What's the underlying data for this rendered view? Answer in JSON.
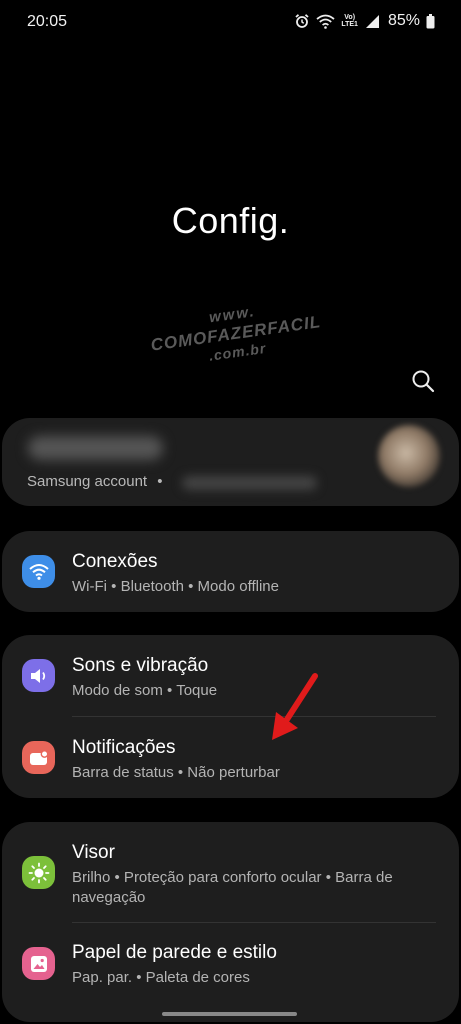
{
  "status_bar": {
    "time": "20:05",
    "lte_top": "Vo)",
    "lte_bottom": "LTE1",
    "battery": "85%",
    "icons": [
      "alarm-icon",
      "wifi-icon",
      "volte-icon",
      "signal-icon",
      "battery-icon"
    ]
  },
  "header": {
    "title": "Config.",
    "search_icon": "search-icon"
  },
  "watermark": {
    "line1": "www.",
    "line2": "COMOFAZERFACIL",
    "line3": ".com.br"
  },
  "account": {
    "subtitle": "Samsung account",
    "separator": "•"
  },
  "settings": {
    "connections": {
      "title": "Conexões",
      "subtitle": "Wi-Fi  •  Bluetooth  •  Modo offline",
      "icon": "wifi-icon",
      "color": "#3e8ee8"
    },
    "sound": {
      "title": "Sons e vibração",
      "subtitle": "Modo de som  •  Toque",
      "icon": "volume-icon",
      "color": "#7d6fe8"
    },
    "notifications": {
      "title": "Notificações",
      "subtitle": "Barra de status  •  Não perturbar",
      "icon": "notification-icon",
      "color": "#e8665a"
    },
    "display": {
      "title": "Visor",
      "subtitle": "Brilho  •  Proteção para conforto ocular  •  Barra de navegação",
      "icon": "sun-icon",
      "color": "#7cc03a"
    },
    "wallpaper": {
      "title": "Papel de parede e estilo",
      "subtitle": "Pap. par.  •  Paleta de cores",
      "icon": "wallpaper-icon",
      "color": "#e5628f"
    }
  },
  "annotation": {
    "arrow_color": "#e01b1b"
  }
}
